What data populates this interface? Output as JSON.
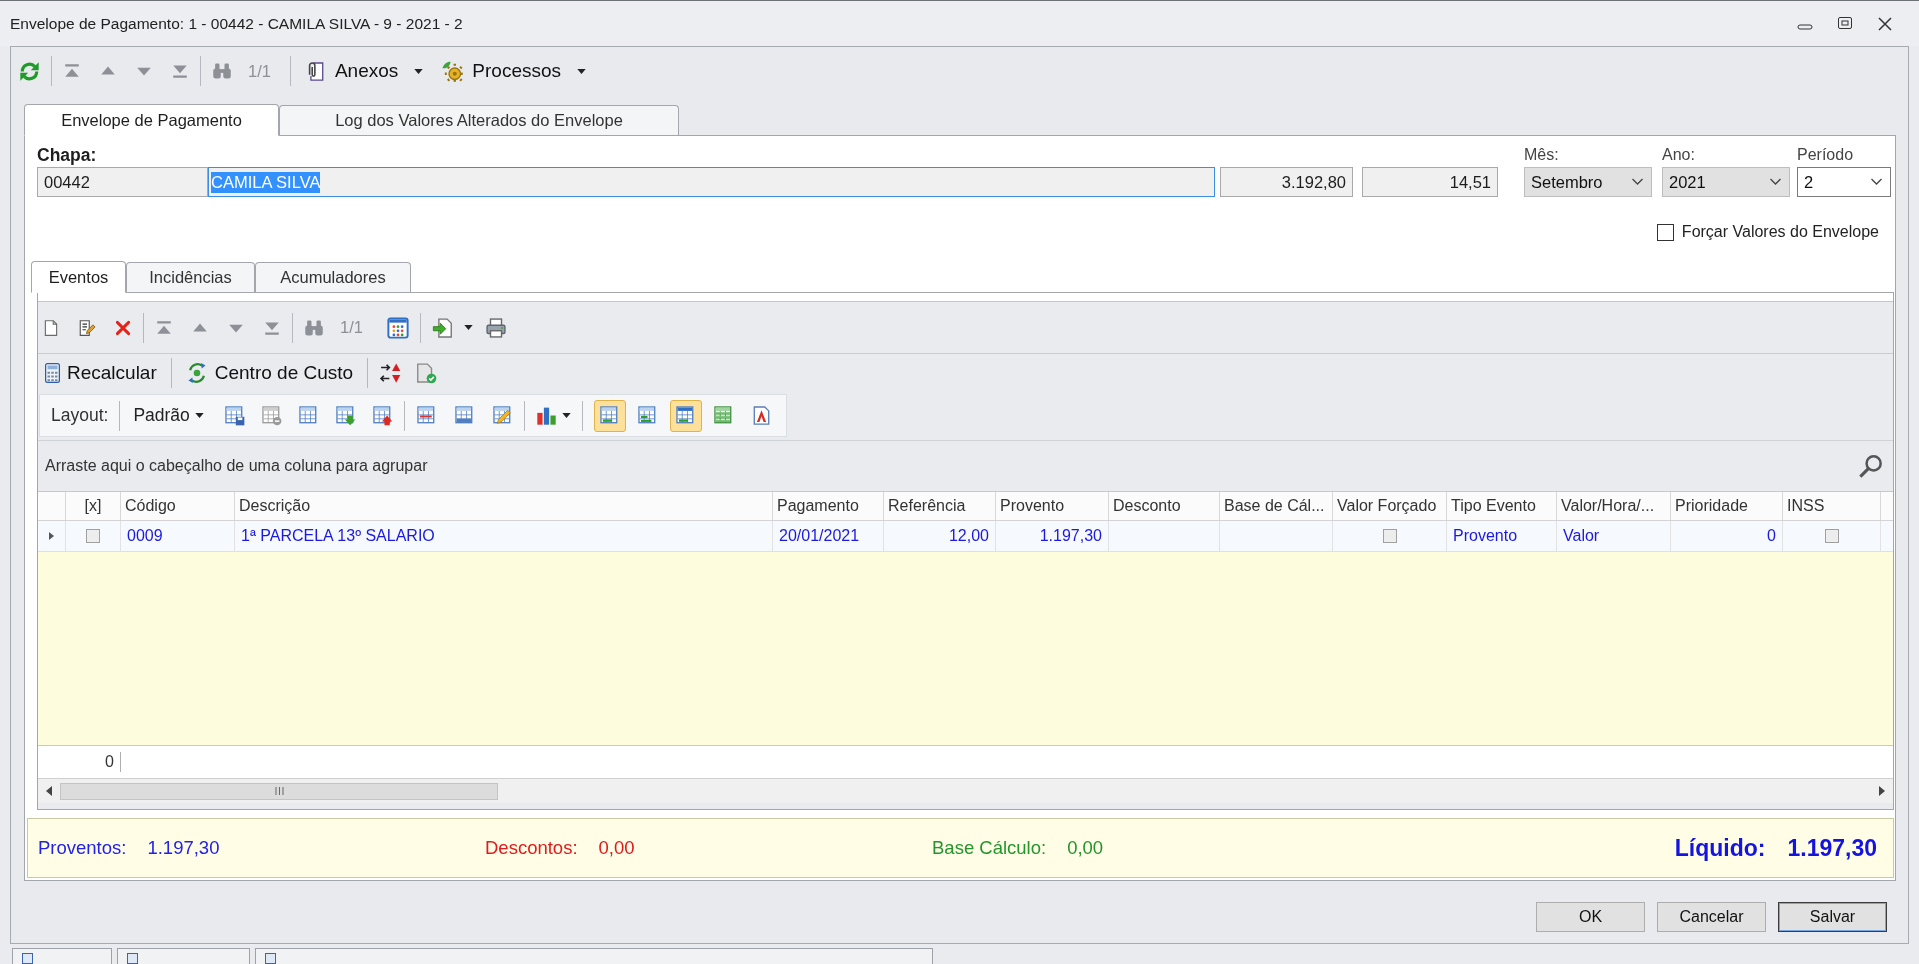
{
  "window": {
    "title": "Envelope de Pagamento: 1 - 00442 - CAMILA SILVA - 9 - 2021 - 2"
  },
  "toolbar": {
    "pager": "1/1",
    "navigation_disabled": true,
    "menus": [
      {
        "kind": "attachments",
        "label": "Anexos"
      },
      {
        "kind": "processes",
        "label": "Processos"
      }
    ]
  },
  "tabs": [
    {
      "label": "Envelope de Pagamento",
      "selected": true
    },
    {
      "label": "Log dos Valores Alterados do Envelope",
      "selected": false
    }
  ],
  "form": {
    "chapa": {
      "label": "Chapa:",
      "code": "00442",
      "name": "CAMILA SILVA",
      "text_selected": true
    },
    "amounts": [
      "3.192,80",
      "14,51"
    ],
    "selects": [
      {
        "label": "Mês:",
        "value": "Setembro",
        "disabled": true
      },
      {
        "label": "Ano:",
        "value": "2021",
        "disabled": true
      },
      {
        "label": "Período",
        "value": "2",
        "disabled": false
      }
    ],
    "force_values": {
      "label": "Forçar Valores do Envelope",
      "checked": false
    }
  },
  "sub_tabs": [
    {
      "label": "Eventos",
      "selected": true
    },
    {
      "label": "Incidências",
      "selected": false
    },
    {
      "label": "Acumuladores",
      "selected": false
    }
  ],
  "events_toolbar": {
    "pager": "1/1",
    "navigation_disabled": true
  },
  "actions": [
    {
      "kind": "calculator",
      "label": "Recalcular"
    },
    {
      "kind": "cost_center",
      "label": "Centro de Custo"
    }
  ],
  "layout_bar": {
    "label": "Layout:",
    "preset": "Padrão",
    "view_buttons": [
      {
        "selected": true
      },
      {
        "selected": false
      },
      {
        "selected": true
      },
      {
        "selected": false
      },
      {
        "selected": false
      }
    ]
  },
  "grid": {
    "group_hint": "Arraste aqui o cabeçalho de uma coluna para agrupar",
    "columns": [
      "[x]",
      "Código",
      "Descrição",
      "Pagamento",
      "Referência",
      "Provento",
      "Desconto",
      "Base de Cál...",
      "Valor Forçado",
      "Tipo Evento",
      "Valor/Hora/...",
      "Prioridade",
      "INSS"
    ],
    "rows": [
      {
        "selected": true,
        "cells": [
          {
            "kind": "check",
            "checked": false
          },
          {
            "kind": "text",
            "text": "0009"
          },
          {
            "kind": "text",
            "text": "1ª PARCELA 13º SALARIO"
          },
          {
            "kind": "text",
            "text": "20/01/2021"
          },
          {
            "kind": "number",
            "text": "12,00"
          },
          {
            "kind": "number",
            "text": "1.197,30"
          },
          {
            "kind": "blank"
          },
          {
            "kind": "blank"
          },
          {
            "kind": "check",
            "checked": false
          },
          {
            "kind": "text",
            "text": "Provento"
          },
          {
            "kind": "text",
            "text": "Valor"
          },
          {
            "kind": "number",
            "text": "0"
          },
          {
            "kind": "check",
            "checked": false
          }
        ]
      }
    ],
    "footer": {
      "count": "0"
    }
  },
  "summary": [
    {
      "kind": "amount",
      "label": "Proventos:",
      "value": "1.197,30",
      "color": "#2222e6"
    },
    {
      "kind": "amount",
      "label": "Descontos:",
      "value": "0,00",
      "color": "#e01b1b"
    },
    {
      "kind": "amount",
      "label": "Base Cálculo:",
      "value": "0,00",
      "color": "#23952b"
    },
    {
      "kind": "total",
      "label": "Líquido:",
      "value": "1.197,30",
      "color": "#1414e0"
    }
  ],
  "buttons": [
    {
      "label": "OK",
      "focused": false
    },
    {
      "label": "Cancelar",
      "focused": false
    },
    {
      "label": "Salvar",
      "focused": true
    }
  ]
}
